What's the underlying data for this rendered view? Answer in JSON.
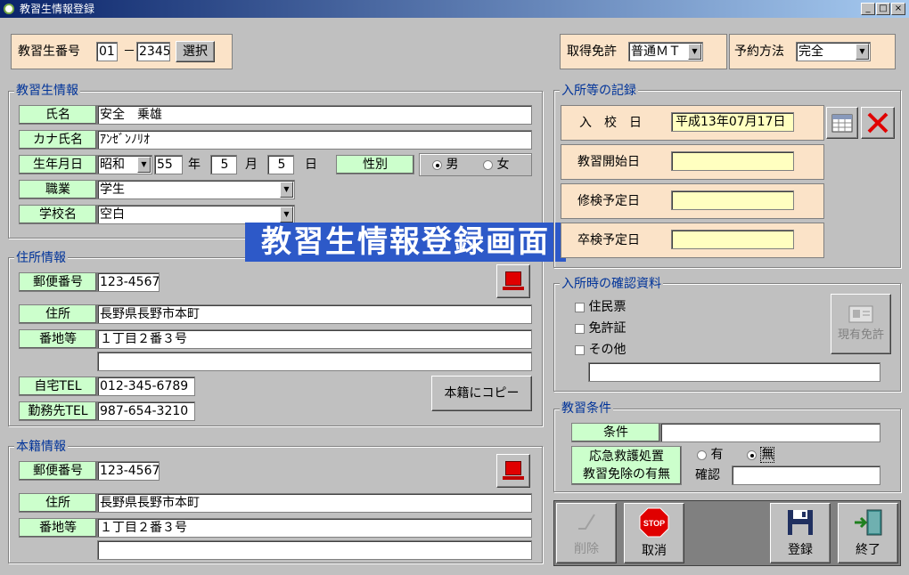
{
  "window": {
    "title": "教習生情報登録",
    "min": "_",
    "max": "□",
    "close": "×"
  },
  "top": {
    "student_no_label": "教習生番号",
    "no_part1": "01",
    "dash": "－",
    "no_part2": "2345",
    "select_btn": "選択",
    "license_label": "取得免許",
    "license_value": "普通ＭＴ",
    "reserve_label": "予約方法",
    "reserve_value": "完全"
  },
  "student": {
    "group": "教習生情報",
    "name_label": "氏名",
    "name_value": "安全　乗雄",
    "kana_label": "カナ氏名",
    "kana_value": "ｱﾝｾﾞﾝﾉﾘｵ",
    "birth_label": "生年月日",
    "era": "昭和",
    "year": "55",
    "year_unit": "年",
    "month": "5",
    "month_unit": "月",
    "day": "5",
    "day_unit": "日",
    "gender_label": "性別",
    "male": "男",
    "female": "女",
    "gender_selected": "男",
    "job_label": "職業",
    "job_value": "学生",
    "school_label": "学校名",
    "school_value": "空白"
  },
  "overlay": {
    "text": "教習生情報登録画面"
  },
  "address": {
    "group": "住所情報",
    "zip_label": "郵便番号",
    "zip_value": "123-4567",
    "addr_label": "住所",
    "addr_value": "長野県長野市本町",
    "banchi_label": "番地等",
    "banchi_value": "１丁目２番３号",
    "banchi_value2": "",
    "home_tel_label": "自宅TEL",
    "home_tel_value": "012-345-6789",
    "work_tel_label": "勤務先TEL",
    "work_tel_value": "987-654-3210",
    "copy_btn": "本籍にコピー"
  },
  "honseki": {
    "group": "本籍情報",
    "zip_label": "郵便番号",
    "zip_value": "123-4567",
    "addr_label": "住所",
    "addr_value": "長野県長野市本町",
    "banchi_label": "番地等",
    "banchi_value": "１丁目２番３号",
    "banchi_value2": ""
  },
  "record": {
    "group": "入所等の記録",
    "enter_label": "入　校　日",
    "enter_value": "平成13年07月17日",
    "start_label": "教習開始日",
    "start_value": "",
    "shuken_label": "修検予定日",
    "shuken_value": "",
    "sotsuken_label": "卒検予定日",
    "sotsuken_value": ""
  },
  "docs": {
    "group": "入所時の確認資料",
    "item1": "住民票",
    "item2": "免許証",
    "item3": "その他",
    "other_value": "",
    "current_license_btn": "現有免許"
  },
  "conditions": {
    "group": "教習条件",
    "cond_label": "条件",
    "cond_value": "",
    "firstaid_label1": "応急救護処置",
    "firstaid_label2": "教習免除の有無",
    "yes": "有",
    "no": "無",
    "selected": "無",
    "confirm_label": "確認",
    "confirm_value": ""
  },
  "actions": {
    "delete": "削除",
    "cancel": "取消",
    "register": "登録",
    "exit": "終了",
    "stop": "STOP"
  },
  "colors": {
    "label_bg": "#ccffcc",
    "peach": "#fbe3c8",
    "yellow_input": "#ffffc0",
    "group_title": "#003399",
    "overlay_bg": "#2d59c8"
  }
}
